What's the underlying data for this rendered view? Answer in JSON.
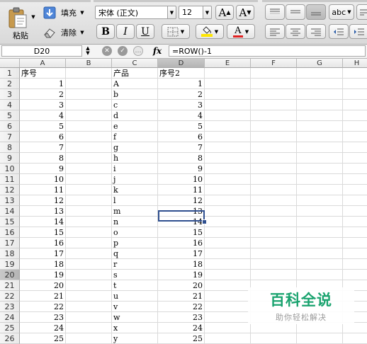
{
  "ribbon": {
    "paste_label": "粘贴",
    "fill_label": "填充",
    "clear_label": "清除",
    "font_name": "宋体 (正文)",
    "font_size": "12",
    "bold": "B",
    "italic": "I",
    "underline": "U",
    "grow_font": "A",
    "shrink_font": "A",
    "font_color_glyph": "A",
    "format_label": "abc"
  },
  "formula_bar": {
    "name_box": "D20",
    "fx": "fx",
    "formula": "=ROW()-1"
  },
  "sheet": {
    "columns": [
      "A",
      "B",
      "C",
      "D",
      "E",
      "F",
      "G",
      "H"
    ],
    "selected_column": "D",
    "selected_row": "20",
    "rows": [
      {
        "n": "1",
        "a": "序号",
        "c": "产品",
        "d": "序号2"
      },
      {
        "n": "2",
        "a": "1",
        "c": "A",
        "d": "1"
      },
      {
        "n": "3",
        "a": "2",
        "c": "b",
        "d": "2"
      },
      {
        "n": "4",
        "a": "3",
        "c": "c",
        "d": "3"
      },
      {
        "n": "5",
        "a": "4",
        "c": "d",
        "d": "4"
      },
      {
        "n": "6",
        "a": "5",
        "c": "e",
        "d": "5"
      },
      {
        "n": "7",
        "a": "6",
        "c": "f",
        "d": "6"
      },
      {
        "n": "8",
        "a": "7",
        "c": "g",
        "d": "7"
      },
      {
        "n": "9",
        "a": "8",
        "c": "h",
        "d": "8"
      },
      {
        "n": "10",
        "a": "9",
        "c": "i",
        "d": "9"
      },
      {
        "n": "11",
        "a": "10",
        "c": "j",
        "d": "10"
      },
      {
        "n": "12",
        "a": "11",
        "c": "k",
        "d": "11"
      },
      {
        "n": "13",
        "a": "12",
        "c": "l",
        "d": "12"
      },
      {
        "n": "14",
        "a": "13",
        "c": "m",
        "d": "13"
      },
      {
        "n": "15",
        "a": "14",
        "c": "n",
        "d": "14"
      },
      {
        "n": "16",
        "a": "15",
        "c": "o",
        "d": "15"
      },
      {
        "n": "17",
        "a": "16",
        "c": "p",
        "d": "16"
      },
      {
        "n": "18",
        "a": "17",
        "c": "q",
        "d": "17"
      },
      {
        "n": "19",
        "a": "18",
        "c": "r",
        "d": "18"
      },
      {
        "n": "20",
        "a": "19",
        "c": "s",
        "d": "19"
      },
      {
        "n": "21",
        "a": "20",
        "c": "t",
        "d": "20"
      },
      {
        "n": "22",
        "a": "21",
        "c": "u",
        "d": "21"
      },
      {
        "n": "23",
        "a": "22",
        "c": "v",
        "d": "22"
      },
      {
        "n": "24",
        "a": "23",
        "c": "w",
        "d": "23"
      },
      {
        "n": "25",
        "a": "24",
        "c": "x",
        "d": "24"
      },
      {
        "n": "26",
        "a": "25",
        "c": "y",
        "d": "25"
      }
    ]
  },
  "watermark": {
    "title": "百科全说",
    "subtitle": "助你轻松解决"
  },
  "colors": {
    "selection_border": "#2f4f8f",
    "watermark_green": "#1aa36f",
    "font_color_bar": "#e02020",
    "highlight_bar": "#ffe600"
  }
}
